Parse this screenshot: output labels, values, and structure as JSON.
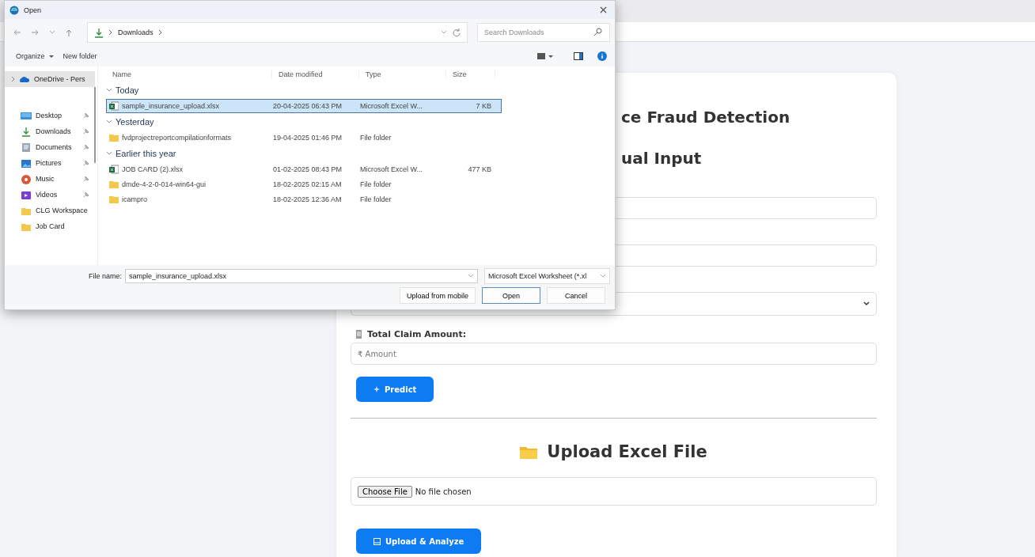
{
  "dialog": {
    "title": "Open",
    "path": [
      "Downloads"
    ],
    "search": {
      "placeholder": "Search Downloads"
    },
    "toolbar": [
      "Organize",
      "New folder"
    ],
    "nav": [
      {
        "label": "OneDrive - Pers",
        "selected": true,
        "pinned": false
      },
      {
        "label": "Desktop",
        "selected": false,
        "pinned": true
      },
      {
        "label": "Downloads",
        "selected": false,
        "pinned": true
      },
      {
        "label": "Documents",
        "selected": false,
        "pinned": true
      },
      {
        "label": "Pictures",
        "selected": false,
        "pinned": true
      },
      {
        "label": "Music",
        "selected": false,
        "pinned": true
      },
      {
        "label": "Videos",
        "selected": false,
        "pinned": true
      },
      {
        "label": "CLG Workspace",
        "selected": false,
        "pinned": false
      },
      {
        "label": "Job Card",
        "selected": false,
        "pinned": false
      }
    ],
    "columns": [
      "Name",
      "Date modified",
      "Type",
      "Size"
    ],
    "groups": [
      {
        "label": "Today",
        "expanded": true,
        "rows": [
          {
            "kind": "excel",
            "name": "sample_insurance_upload.xlsx",
            "date": "20-04-2025 06:43 PM",
            "type": "Microsoft Excel W...",
            "size": "7 KB",
            "selected": true
          }
        ]
      },
      {
        "label": "Yesterday",
        "expanded": true,
        "rows": [
          {
            "kind": "folder",
            "name": "fvdprojectreportcompilationformats",
            "date": "19-04-2025 01:46 PM",
            "type": "File folder",
            "selected": false
          }
        ]
      },
      {
        "label": "Earlier this year",
        "expanded": true,
        "rows": [
          {
            "kind": "excel",
            "name": "JOB CARD (2).xlsx",
            "date": "01-02-2025 08:43 PM",
            "type": "Microsoft Excel W...",
            "size": "477 KB",
            "selected": false
          },
          {
            "kind": "folder",
            "name": "dmde-4-2-0-014-win64-gui",
            "date": "18-02-2025 02:15 AM",
            "type": "File folder",
            "selected": false
          },
          {
            "kind": "folder",
            "name": "icampro",
            "date": "18-02-2025 12:36 AM",
            "type": "File folder",
            "selected": false
          }
        ]
      }
    ],
    "file_name": {
      "label": "File name:",
      "value": "sample_insurance_upload.xlsx"
    },
    "filter": "Microsoft Excel Worksheet (*.xl",
    "buttons": [
      {
        "label": "Upload from mobile",
        "default": false
      },
      {
        "label": "Open",
        "default": true
      },
      {
        "label": "Cancel",
        "default": false
      }
    ]
  },
  "page": {
    "title": "ce Fraud Detection",
    "subtitle": "ual Input",
    "fields": [
      {
        "kind": "text"
      },
      {
        "kind": "text"
      },
      {
        "kind": "select"
      }
    ],
    "claim": {
      "label": "Total Claim Amount:",
      "placeholder": "₹ Amount"
    },
    "predict_button": "Predict",
    "upload_title": "Upload Excel File",
    "file_input": {
      "button": "Choose File",
      "status": "No file chosen"
    },
    "upload_button": "Upload & Analyze"
  }
}
